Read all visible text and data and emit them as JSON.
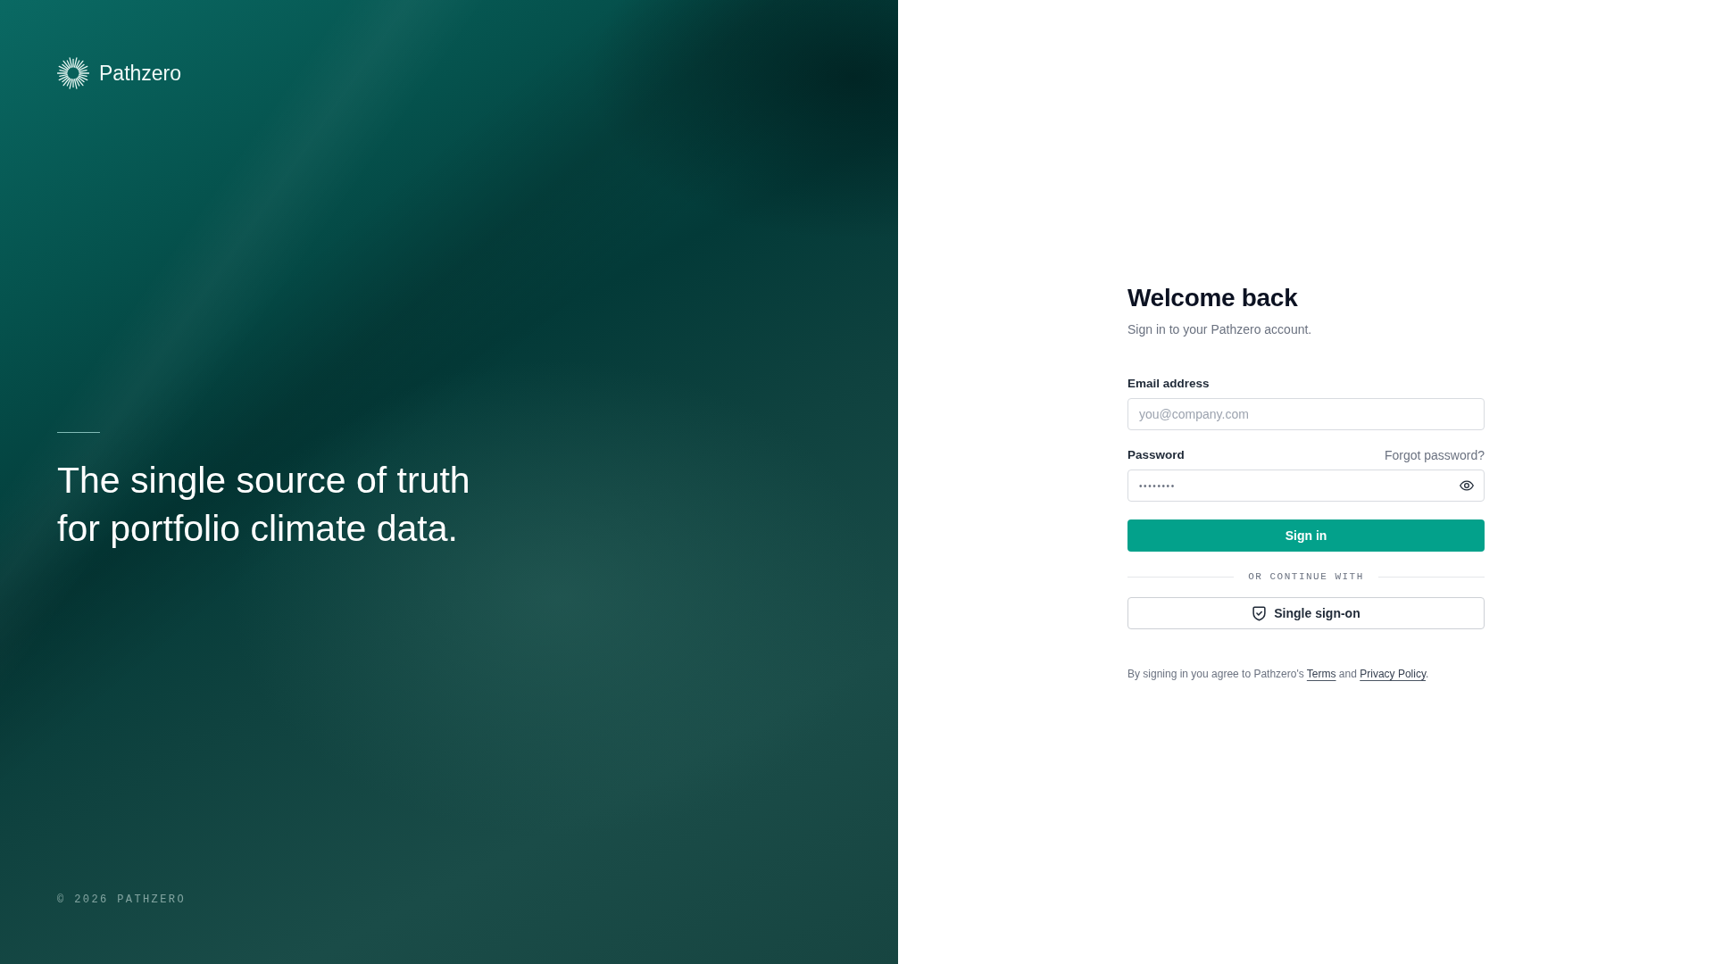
{
  "brand": {
    "name": "Pathzero"
  },
  "hero": {
    "tagline": "The single source of truth for portfolio climate data.",
    "footer": "© 2026 PATHZERO"
  },
  "form": {
    "title": "Welcome back",
    "subtitle": "Sign in to your Pathzero account.",
    "fields": [
      {
        "kind": "email",
        "label": "Email address",
        "placeholder": "you@company.com"
      },
      {
        "kind": "password",
        "label": "Password",
        "link": "Forgot password?",
        "value": "••••••••"
      }
    ],
    "submit": "Sign in",
    "divider": "OR CONTINUE WITH",
    "sso_button": "Single sign-on",
    "legal": [
      {
        "kind": "text",
        "text": "By signing in you agree to Pathzero's "
      },
      {
        "kind": "link",
        "text": "Terms"
      },
      {
        "kind": "text",
        "text": " and "
      },
      {
        "kind": "link",
        "text": "Privacy Policy"
      },
      {
        "kind": "text",
        "text": "."
      }
    ]
  }
}
